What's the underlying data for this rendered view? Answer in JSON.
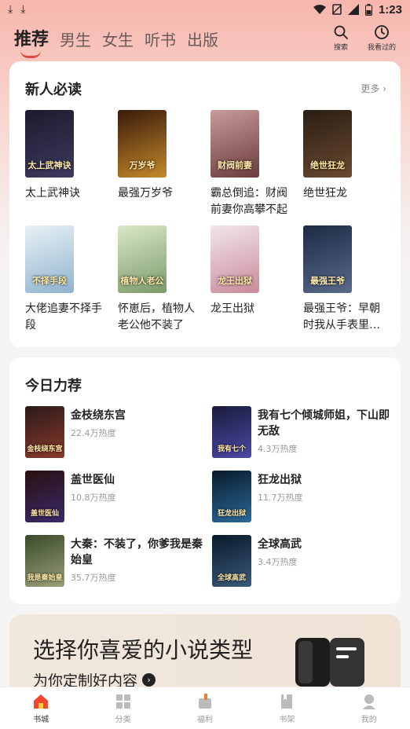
{
  "status": {
    "time": "1:23"
  },
  "header": {
    "tabs": [
      {
        "label": "推荐",
        "active": true
      },
      {
        "label": "男生"
      },
      {
        "label": "女生"
      },
      {
        "label": "听书"
      },
      {
        "label": "出版"
      }
    ],
    "search_label": "搜索",
    "history_label": "我看过的"
  },
  "newbie": {
    "title": "新人必读",
    "more": "更多",
    "books": [
      {
        "name": "太上武神诀",
        "cover_text": "太上武神诀",
        "c1": "#1b1b2e",
        "c2": "#3d3a5e"
      },
      {
        "name": "最强万岁爷",
        "cover_text": "万岁爷",
        "c1": "#3a1a0a",
        "c2": "#c48a2a"
      },
      {
        "name": "霸总倒追：财阀前妻你高攀不起",
        "cover_text": "财阀前妻",
        "c1": "#c99a9a",
        "c2": "#6b3b3b"
      },
      {
        "name": "绝世狂龙",
        "cover_text": "绝世狂龙",
        "c1": "#2b1e14",
        "c2": "#6a4a30"
      },
      {
        "name": "大佬追妻不择手段",
        "cover_text": "不择手段",
        "c1": "#e8f1f5",
        "c2": "#8fb3cf"
      },
      {
        "name": "怀崽后，植物人老公他不装了",
        "cover_text": "植物人老公",
        "c1": "#d9e8c8",
        "c2": "#7c9a6a"
      },
      {
        "name": "龙王出狱",
        "cover_text": "龙王出狱",
        "c1": "#f2e6ea",
        "c2": "#c98a9a"
      },
      {
        "name": "最强王爷：早朝时我从手表里掏出一门小钢炮",
        "cover_text": "最强王爷",
        "c1": "#1c2a44",
        "c2": "#5a6a8a"
      }
    ]
  },
  "daily": {
    "title": "今日力荐",
    "books": [
      {
        "title": "金枝绕东宫",
        "heat": "22.4万热度",
        "cover_text": "金枝绕东宫",
        "c1": "#2a1a1a",
        "c2": "#8a3a2a"
      },
      {
        "title": "我有七个倾城师姐，下山即无敌",
        "heat": "4.3万热度",
        "cover_text": "我有七个",
        "c1": "#1a1a3a",
        "c2": "#4a4aaa"
      },
      {
        "title": "盖世医仙",
        "heat": "10.8万热度",
        "cover_text": "盖世医仙",
        "c1": "#2a1010",
        "c2": "#3a2a6a"
      },
      {
        "title": "狂龙出狱",
        "heat": "11.7万热度",
        "cover_text": "狂龙出狱",
        "c1": "#0a1a2a",
        "c2": "#2a6a9a"
      },
      {
        "title": "大秦：不装了，你爹我是秦始皇",
        "heat": "35.7万热度",
        "cover_text": "我是秦始皇",
        "c1": "#3a4a2a",
        "c2": "#9aa07a"
      },
      {
        "title": "全球高武",
        "heat": "3.4万热度",
        "cover_text": "全球高武",
        "c1": "#0a1a2a",
        "c2": "#3a5a7a"
      }
    ]
  },
  "banner": {
    "title": "选择你喜爱的小说类型",
    "subtitle": "为你定制好内容"
  },
  "nav": {
    "items": [
      {
        "label": "书城",
        "active": true
      },
      {
        "label": "分类"
      },
      {
        "label": "福利"
      },
      {
        "label": "书架"
      },
      {
        "label": "我的"
      }
    ]
  },
  "colors": {
    "accent": "#e04a3c"
  }
}
